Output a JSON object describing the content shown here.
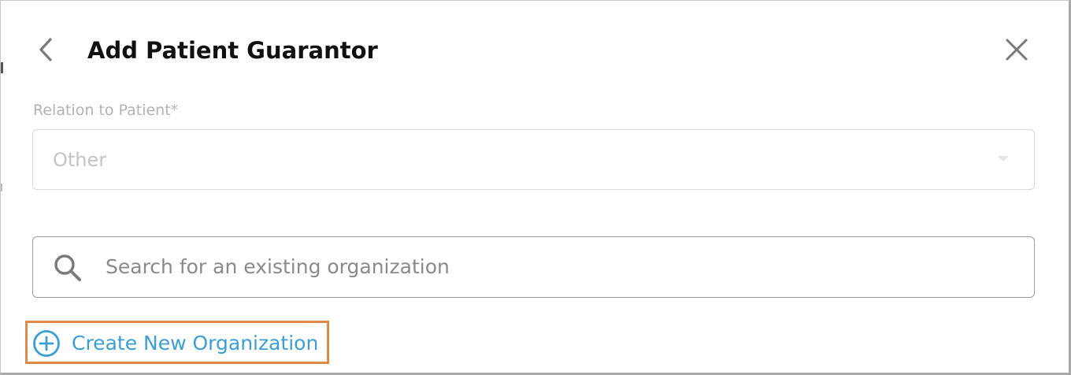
{
  "header": {
    "title": "Add Patient Guarantor",
    "back_icon": "chevron-left-icon",
    "close_icon": "close-icon"
  },
  "relation_field": {
    "label": "Relation to Patient*",
    "value": "Other",
    "caret_icon": "caret-down-icon"
  },
  "search": {
    "placeholder": "Search for an existing organization",
    "icon": "search-icon"
  },
  "create_org": {
    "label": "Create New Organization",
    "icon": "plus-circle-icon",
    "highlight_color": "#e08a4a"
  },
  "colors": {
    "link": "#3a9fd6",
    "title": "#111111",
    "muted": "#b3b3b3"
  }
}
